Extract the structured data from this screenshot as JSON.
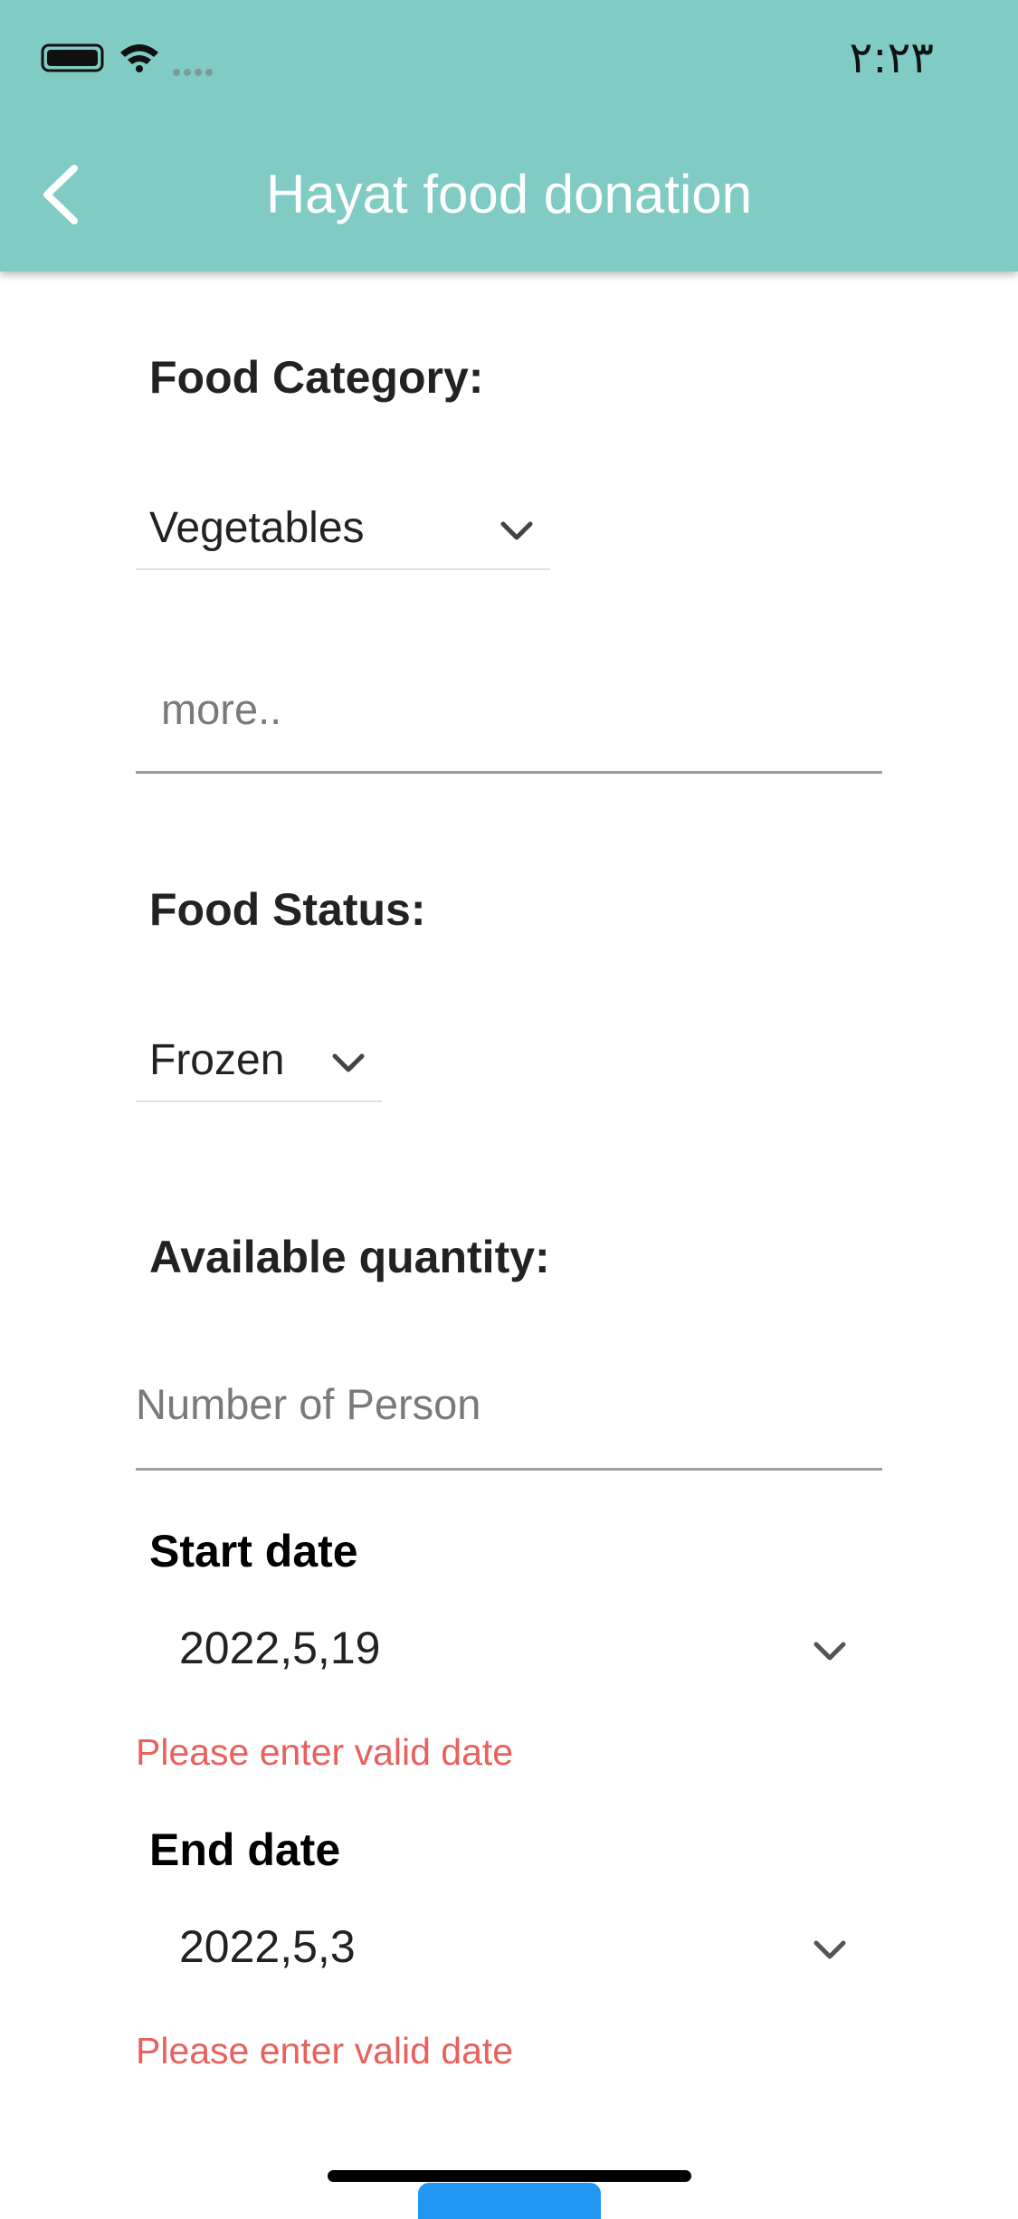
{
  "status_bar": {
    "time": "٢:٢٣"
  },
  "app_bar": {
    "title": "Hayat food donation"
  },
  "food_category": {
    "label": "Food Category:",
    "selected": "Vegetables"
  },
  "more_field": {
    "placeholder": "more.."
  },
  "food_status": {
    "label": "Food Status:",
    "selected": "Frozen"
  },
  "quantity": {
    "label": "Available quantity:",
    "placeholder": "Number of Person"
  },
  "start_date": {
    "label": "Start date",
    "value": "2022,5,19",
    "error": "Please enter valid date"
  },
  "end_date": {
    "label": "End date",
    "value": "2022,5,3",
    "error": "Please enter valid date"
  },
  "colors": {
    "app_bar": "#80cbc4",
    "error": "#e9605c",
    "button": "#2196f3"
  }
}
